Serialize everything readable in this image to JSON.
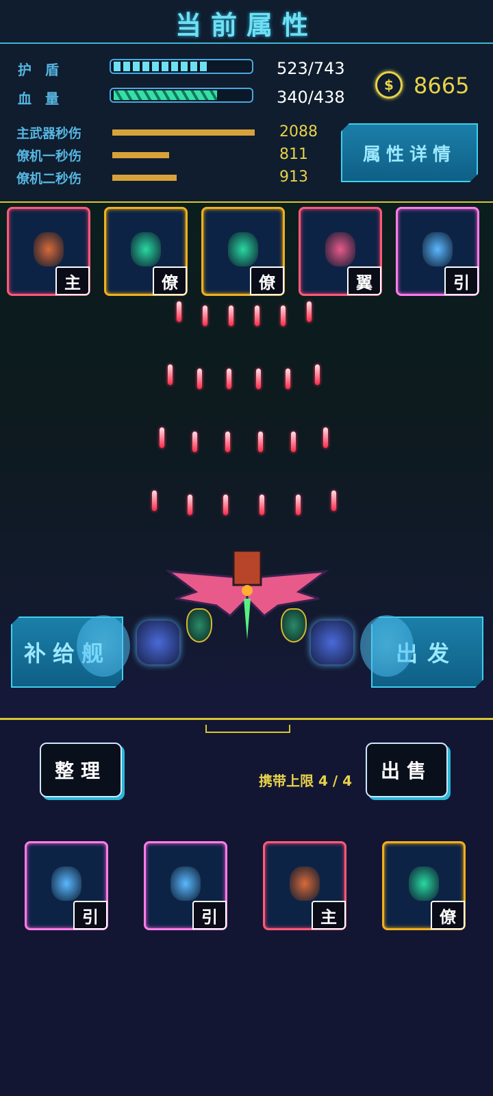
{
  "header": {
    "title": "当前属性"
  },
  "stats": {
    "shield": {
      "label": "护　盾",
      "value": "523/743",
      "fraction": 0.7
    },
    "hp": {
      "label": "血　量",
      "value": "340/438",
      "fraction": 0.78
    },
    "coins": "8665",
    "dps": [
      {
        "label": "主武器秒伤",
        "value": "2088",
        "fraction": 1.0
      },
      {
        "label": "僚机一秒伤",
        "value": "811",
        "fraction": 0.4
      },
      {
        "label": "僚机二秒伤",
        "value": "913",
        "fraction": 0.45
      }
    ],
    "details_button": "属性详情"
  },
  "equipped": [
    {
      "tag": "主",
      "rarity": "red",
      "icon": "main-weapon-icon"
    },
    {
      "tag": "僚",
      "rarity": "gold",
      "icon": "wingman-ship-icon"
    },
    {
      "tag": "僚",
      "rarity": "gold",
      "icon": "wingman-ship-icon"
    },
    {
      "tag": "翼",
      "rarity": "red",
      "icon": "wing-icon"
    },
    {
      "tag": "引",
      "rarity": "pink",
      "icon": "engine-icon"
    }
  ],
  "arena": {
    "supply_button": "补给舰",
    "launch_button": "出发"
  },
  "inventory": {
    "sort_button": "整理",
    "sell_button": "出售",
    "capacity_text": "携带上限 4 / 4",
    "items": [
      {
        "tag": "引",
        "rarity": "pink",
        "icon": "engine-icon"
      },
      {
        "tag": "引",
        "rarity": "pink",
        "icon": "engine-icon"
      },
      {
        "tag": "主",
        "rarity": "red",
        "icon": "main-weapon-icon"
      },
      {
        "tag": "僚",
        "rarity": "gold",
        "icon": "wingman-ship-icon"
      }
    ]
  },
  "colors": {
    "accent": "#3fd0f0",
    "gold": "#e8d24a",
    "shield": "#6fe0f2",
    "hp": "#35e0a8"
  }
}
